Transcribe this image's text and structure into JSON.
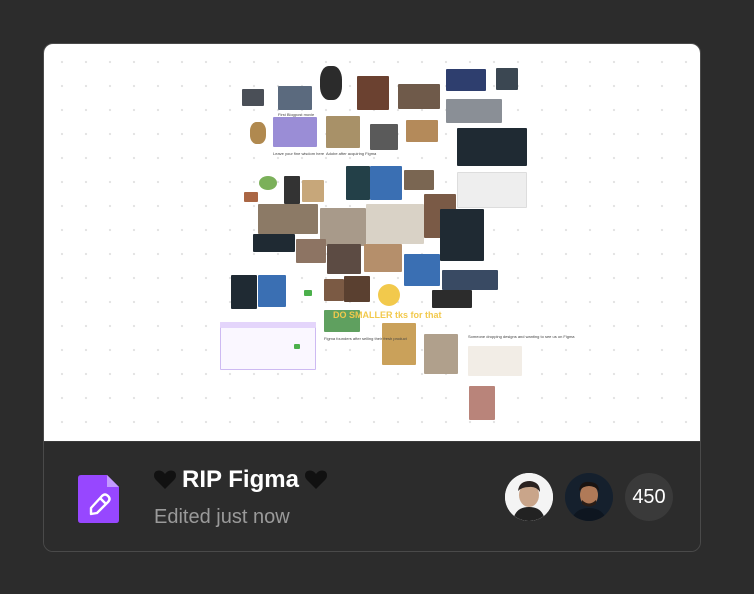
{
  "file": {
    "title": "RIP Figma",
    "title_icon": "black-heart-icon",
    "edited": "Edited just now",
    "type_icon": "figjam-file-icon",
    "type_color": "#9747ff"
  },
  "collaborators": {
    "avatars": [
      "avatar-user-1",
      "avatar-user-2"
    ],
    "count": "450"
  },
  "canvas": {
    "highlight_text": "DO SMALLER tks for that",
    "captions": {
      "c1": "First Blogpost movie",
      "c2": "Leave your fine wisdom here",
      "c3": "Adobe after acquiring Figma",
      "c4": "Figma founders after selling their fresh product",
      "c5": "Someone dropping designs and wanting to see us on Figma"
    }
  },
  "colors": {
    "background": "#2c2c2c",
    "card_border": "#4a4a4a",
    "title": "#ffffff",
    "subtitle": "#9a9a9a"
  }
}
